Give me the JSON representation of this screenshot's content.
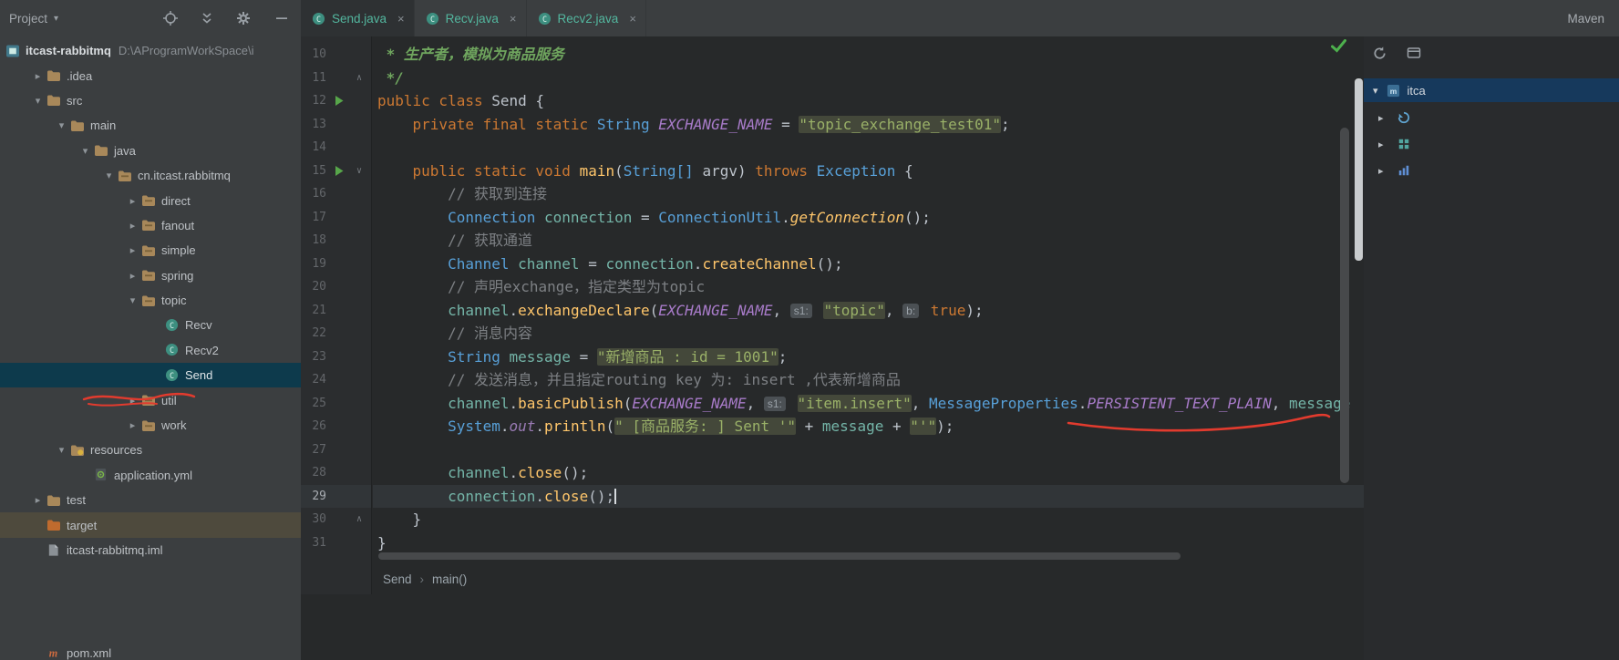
{
  "toolbar": {
    "project_label": "Project",
    "maven_label": "Maven"
  },
  "tabs": [
    {
      "label": "Send.java",
      "active": true
    },
    {
      "label": "Recv.java",
      "active": false
    },
    {
      "label": "Recv2.java",
      "active": false
    }
  ],
  "project_tree": {
    "items": [
      {
        "label": "itcast-rabbitmq",
        "path": "D:\\AProgramWorkSpace\\i",
        "indent": 0,
        "icon": "project",
        "bold": true,
        "root": true
      },
      {
        "label": ".idea",
        "indent": 1,
        "arrow": "right",
        "icon": "folder"
      },
      {
        "label": "src",
        "indent": 1,
        "arrow": "down",
        "icon": "folder"
      },
      {
        "label": "main",
        "indent": 2,
        "arrow": "down",
        "icon": "folder"
      },
      {
        "label": "java",
        "indent": 3,
        "arrow": "down",
        "icon": "folder"
      },
      {
        "label": "cn.itcast.rabbitmq",
        "indent": 4,
        "arrow": "down",
        "icon": "package"
      },
      {
        "label": "direct",
        "indent": 5,
        "arrow": "right",
        "icon": "package"
      },
      {
        "label": "fanout",
        "indent": 5,
        "arrow": "right",
        "icon": "package"
      },
      {
        "label": "simple",
        "indent": 5,
        "arrow": "right",
        "icon": "package"
      },
      {
        "label": "spring",
        "indent": 5,
        "arrow": "right",
        "icon": "package"
      },
      {
        "label": "topic",
        "indent": 5,
        "arrow": "down",
        "icon": "package"
      },
      {
        "label": "Recv",
        "indent": 6,
        "icon": "class"
      },
      {
        "label": "Recv2",
        "indent": 6,
        "icon": "class"
      },
      {
        "label": "Send",
        "indent": 6,
        "icon": "class",
        "selected": true
      },
      {
        "label": "util",
        "indent": 5,
        "arrow": "right",
        "icon": "package"
      },
      {
        "label": "work",
        "indent": 5,
        "arrow": "right",
        "icon": "package"
      },
      {
        "label": "resources",
        "indent": 2,
        "arrow": "down",
        "icon": "folder-resources"
      },
      {
        "label": "application.yml",
        "indent": 3,
        "icon": "yml"
      },
      {
        "label": "test",
        "indent": 1,
        "arrow": "right",
        "icon": "folder"
      },
      {
        "label": "target",
        "indent": 1,
        "icon": "folder-excluded",
        "excluded": true
      },
      {
        "label": "itcast-rabbitmq.iml",
        "indent": 1,
        "icon": "file-iml"
      },
      {
        "label": "pom.xml",
        "indent": 1,
        "icon": "maven-file",
        "pinned": true
      }
    ]
  },
  "editor": {
    "lines": [
      {
        "n": 10,
        "tokens": [
          [
            "doc",
            " * 生产者，模拟为商品服务"
          ]
        ]
      },
      {
        "n": 11,
        "fold": "up",
        "tokens": [
          [
            "doc",
            " */"
          ]
        ]
      },
      {
        "n": 12,
        "run": true,
        "tokens": [
          [
            "kw",
            "public class "
          ],
          [
            "plain",
            "Send {"
          ]
        ]
      },
      {
        "n": 13,
        "tokens": [
          [
            "plain",
            "    "
          ],
          [
            "kw",
            "private final static "
          ],
          [
            "type",
            "String "
          ],
          [
            "const",
            "EXCHANGE_NAME"
          ],
          [
            "plain",
            " = "
          ],
          [
            "str",
            "\"topic_exchange_test01\""
          ],
          [
            "plain",
            ";"
          ]
        ]
      },
      {
        "n": 14,
        "tokens": []
      },
      {
        "n": 15,
        "run": true,
        "fold": "down",
        "tokens": [
          [
            "plain",
            "    "
          ],
          [
            "kw",
            "public static void "
          ],
          [
            "method",
            "main"
          ],
          [
            "plain",
            "("
          ],
          [
            "type",
            "String[] "
          ],
          [
            "plain",
            "argv) "
          ],
          [
            "kw",
            "throws "
          ],
          [
            "type",
            "Exception "
          ],
          [
            "plain",
            "{"
          ]
        ]
      },
      {
        "n": 16,
        "tokens": [
          [
            "plain",
            "        "
          ],
          [
            "cmt",
            "// 获取到连接"
          ]
        ]
      },
      {
        "n": 17,
        "tokens": [
          [
            "plain",
            "        "
          ],
          [
            "type",
            "Connection "
          ],
          [
            "var",
            "connection"
          ],
          [
            "plain",
            " = "
          ],
          [
            "type",
            "ConnectionUtil"
          ],
          [
            "plain",
            "."
          ],
          [
            "method_s",
            "getConnection"
          ],
          [
            "plain",
            "();"
          ]
        ]
      },
      {
        "n": 18,
        "tokens": [
          [
            "plain",
            "        "
          ],
          [
            "cmt",
            "// 获取通道"
          ]
        ]
      },
      {
        "n": 19,
        "tokens": [
          [
            "plain",
            "        "
          ],
          [
            "type",
            "Channel "
          ],
          [
            "var",
            "channel"
          ],
          [
            "plain",
            " = "
          ],
          [
            "var",
            "connection"
          ],
          [
            "plain",
            "."
          ],
          [
            "method",
            "createChannel"
          ],
          [
            "plain",
            "();"
          ]
        ]
      },
      {
        "n": 20,
        "tokens": [
          [
            "plain",
            "        "
          ],
          [
            "cmt",
            "// 声明exchange，指定类型为topic"
          ]
        ]
      },
      {
        "n": 21,
        "tokens": [
          [
            "plain",
            "        "
          ],
          [
            "var",
            "channel"
          ],
          [
            "plain",
            "."
          ],
          [
            "method",
            "exchangeDeclare"
          ],
          [
            "plain",
            "("
          ],
          [
            "const",
            "EXCHANGE_NAME"
          ],
          [
            "plain",
            ", "
          ],
          [
            "hint",
            "s1:"
          ],
          [
            "plain",
            " "
          ],
          [
            "str",
            "\"topic\""
          ],
          [
            "plain",
            ", "
          ],
          [
            "hint",
            "b:"
          ],
          [
            "plain",
            " "
          ],
          [
            "kw",
            "true"
          ],
          [
            "plain",
            ");"
          ]
        ]
      },
      {
        "n": 22,
        "tokens": [
          [
            "plain",
            "        "
          ],
          [
            "cmt",
            "// 消息内容"
          ]
        ]
      },
      {
        "n": 23,
        "tokens": [
          [
            "plain",
            "        "
          ],
          [
            "type",
            "String "
          ],
          [
            "var",
            "message"
          ],
          [
            "plain",
            " = "
          ],
          [
            "str",
            "\"新增商品 : id = 1001\""
          ],
          [
            "plain",
            ";"
          ]
        ]
      },
      {
        "n": 24,
        "tokens": [
          [
            "plain",
            "        "
          ],
          [
            "cmt",
            "// 发送消息，并且指定routing key 为: insert ,代表新增商品"
          ]
        ]
      },
      {
        "n": 25,
        "tokens": [
          [
            "plain",
            "        "
          ],
          [
            "var",
            "channel"
          ],
          [
            "plain",
            "."
          ],
          [
            "method",
            "basicPublish"
          ],
          [
            "plain",
            "("
          ],
          [
            "const",
            "EXCHANGE_NAME"
          ],
          [
            "plain",
            ", "
          ],
          [
            "hint",
            "s1:"
          ],
          [
            "plain",
            " "
          ],
          [
            "str",
            "\"item.insert\""
          ],
          [
            "plain",
            ", "
          ],
          [
            "type",
            "MessageProperties"
          ],
          [
            "plain",
            "."
          ],
          [
            "const",
            "PERSISTENT_TEXT_PLAIN"
          ],
          [
            "plain",
            ", "
          ],
          [
            "var",
            "message"
          ]
        ]
      },
      {
        "n": 26,
        "tokens": [
          [
            "plain",
            "        "
          ],
          [
            "type",
            "System"
          ],
          [
            "plain",
            "."
          ],
          [
            "field",
            "out"
          ],
          [
            "plain",
            "."
          ],
          [
            "method",
            "println"
          ],
          [
            "plain",
            "("
          ],
          [
            "str",
            "\" [商品服务: ] Sent '\""
          ],
          [
            "plain",
            " + "
          ],
          [
            "var",
            "message"
          ],
          [
            "plain",
            " + "
          ],
          [
            "str",
            "\"'\""
          ],
          [
            "plain",
            ");"
          ]
        ]
      },
      {
        "n": 27,
        "tokens": []
      },
      {
        "n": 28,
        "tokens": [
          [
            "plain",
            "        "
          ],
          [
            "var",
            "channel"
          ],
          [
            "plain",
            "."
          ],
          [
            "method",
            "close"
          ],
          [
            "plain",
            "();"
          ]
        ]
      },
      {
        "n": 29,
        "current": true,
        "caret": true,
        "tokens": [
          [
            "plain",
            "        "
          ],
          [
            "var",
            "connection"
          ],
          [
            "plain",
            "."
          ],
          [
            "method",
            "close"
          ],
          [
            "plain",
            "();"
          ]
        ]
      },
      {
        "n": 30,
        "fold": "up",
        "tokens": [
          [
            "plain",
            "    }"
          ]
        ]
      },
      {
        "n": 31,
        "tokens": [
          [
            "plain",
            "}"
          ]
        ]
      }
    ]
  },
  "breadcrumb": {
    "items": [
      "Send",
      "main()"
    ],
    "separator": "›"
  },
  "maven_panel": {
    "root": {
      "label": "itca"
    },
    "nodes": [
      {
        "icon": "maven-node-blue"
      },
      {
        "icon": "maven-node-teal"
      },
      {
        "icon": "maven-node-bars"
      }
    ]
  },
  "annotations": {
    "color": "#e23b2e",
    "tree_scribble": "red hand-drawn scribble under Send / util in project tree",
    "editor_underline": "red hand-drawn underline below MessageProperties.PERSISTENT_TEXT_PLAIN, message on line 25"
  },
  "icons": [
    "locate-icon",
    "collapse-all-icon",
    "gear-icon",
    "minimize-icon",
    "java-class-icon",
    "project-icon",
    "folder-icon",
    "package-icon",
    "class-icon",
    "yml-icon",
    "file-iml-icon",
    "maven-file-icon",
    "maven-project-icon",
    "refresh-icon",
    "panel-icon",
    "checkmark-icon",
    "chevron-down-icon",
    "chevron-right-icon",
    "run-icon",
    "fold-icon"
  ],
  "palette": {
    "panel-bg": "#3b3e40",
    "editor-bg": "#27292a",
    "selection-bg": "#0d3a4c",
    "tab-text": "#53b79f",
    "annotation-red": "#e23b2e",
    "keyword": "#cc7832",
    "type": "#58a0d8",
    "method": "#ffc66b",
    "string": "#9ab168",
    "comment": "#7d8084"
  }
}
